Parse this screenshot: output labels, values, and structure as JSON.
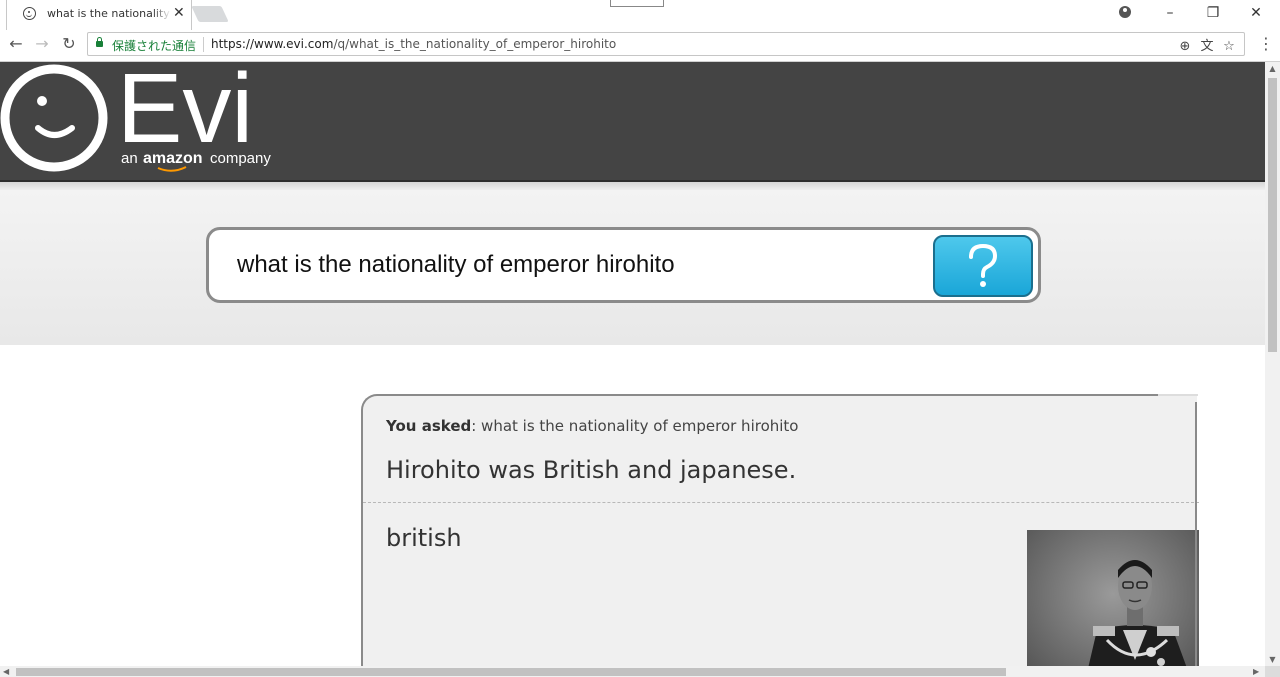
{
  "browser": {
    "tab_title": "what is the nationality of emperor hirohito",
    "tab_close": "✕",
    "window_controls": {
      "minimize": "–",
      "restore": "❐",
      "close": "✕"
    },
    "nav": {
      "back": "←",
      "forward": "→",
      "reload": "↻",
      "menu": "⋮"
    },
    "secure_label": "保護された通信",
    "url_host": "https://www.evi.com",
    "url_path": "/q/what_is_the_nationality_of_emperor_hirohito",
    "omnibox_icons": {
      "zoom": "⊕",
      "translate": "文",
      "bookmark": "☆"
    }
  },
  "header": {
    "logo_text": "Evi",
    "tagline_prefix": "an",
    "tagline_brand": "amazon",
    "tagline_suffix": "company",
    "background_color": "#444444"
  },
  "search": {
    "query": "what is the nationality of emperor hirohito",
    "button_icon": "question-mark-icon",
    "button_color": "#29b3e3"
  },
  "answer": {
    "asked_label": "You asked",
    "asked_query": ": what is the nationality of emperor hirohito",
    "main_answer": "Hirohito was British and japanese.",
    "sub_answer": "british",
    "image_icon": "portrait-photo"
  }
}
